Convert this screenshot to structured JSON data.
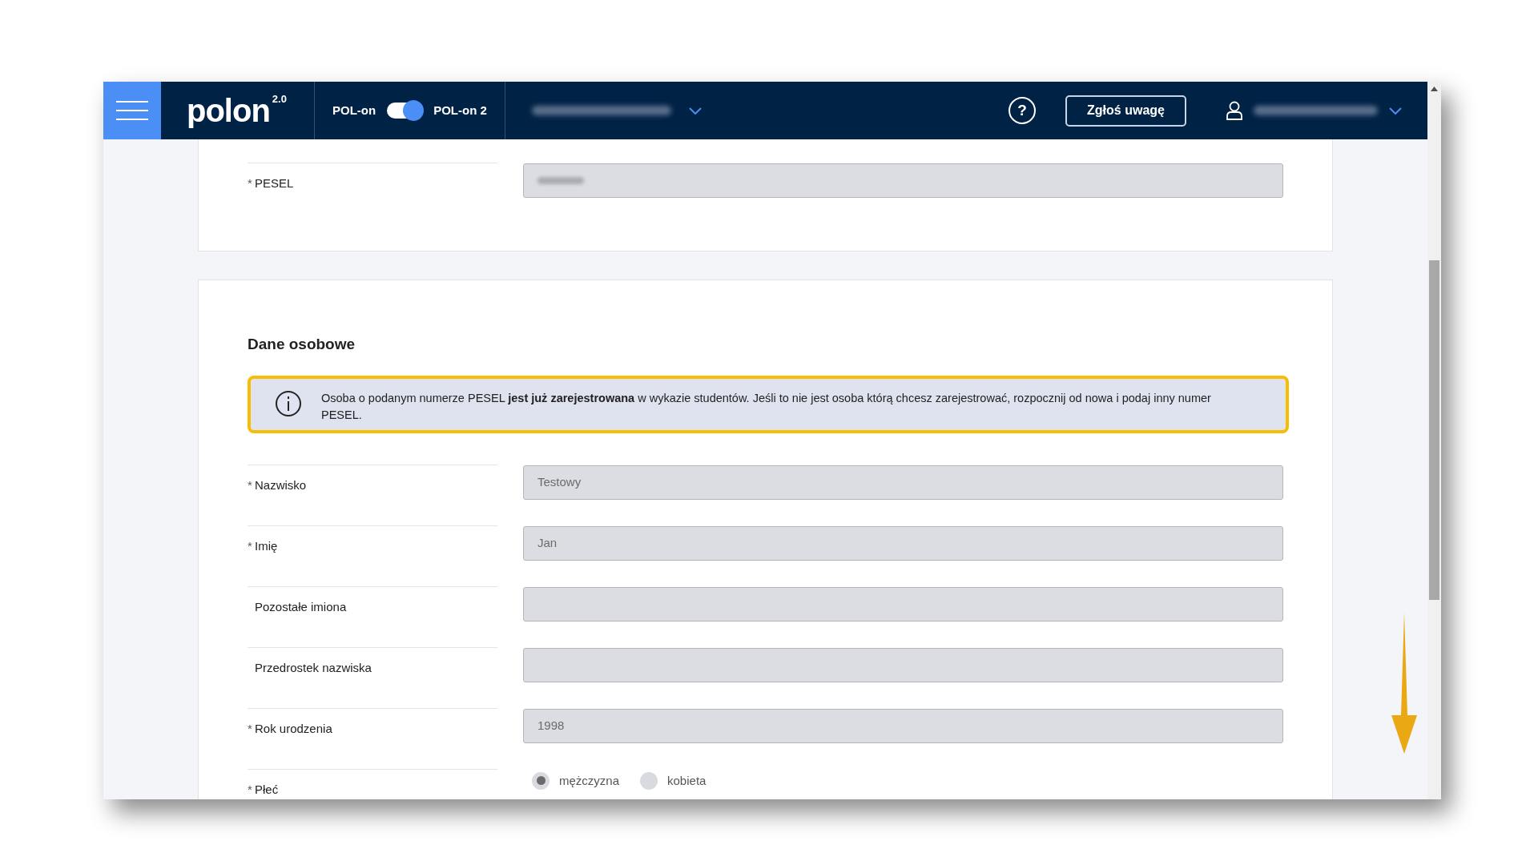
{
  "header": {
    "logo": "polon",
    "logo_version": "2.0",
    "toggle": {
      "left_label": "POL-on",
      "right_label": "POL-on 2",
      "on": true
    },
    "help": "?",
    "report_button": "Zgłoś uwagę"
  },
  "required_mark": "*",
  "sections": [
    {
      "fields": [
        {
          "kind": "redacted",
          "label": "PESEL",
          "required": true
        }
      ]
    },
    {
      "title": "Dane osobowe",
      "notice": {
        "text": "Osoba o podanym numerze PESEL **jest już zarejestrowana** w wykazie studentów. Jeśli to nie jest osoba którą chcesz zarejestrować, rozpocznij od nowa i podaj inny numer PESEL.",
        "highlighted": true
      },
      "fields": [
        {
          "kind": "text",
          "label": "Nazwisko",
          "required": true,
          "value": "Testowy"
        },
        {
          "kind": "text",
          "label": "Imię",
          "required": true,
          "value": "Jan"
        },
        {
          "kind": "text",
          "label": "Pozostałe imiona",
          "required": false
        },
        {
          "kind": "text",
          "label": "Przedrostek nazwiska",
          "required": false
        },
        {
          "kind": "text",
          "label": "Rok urodzenia",
          "required": true,
          "value": "1998"
        },
        {
          "kind": "radio",
          "label": "Płeć",
          "required": true,
          "options": [
            {
              "label": "mężczyzna",
              "selected": true
            },
            {
              "label": "kobieta",
              "selected": false
            }
          ]
        }
      ]
    }
  ]
}
